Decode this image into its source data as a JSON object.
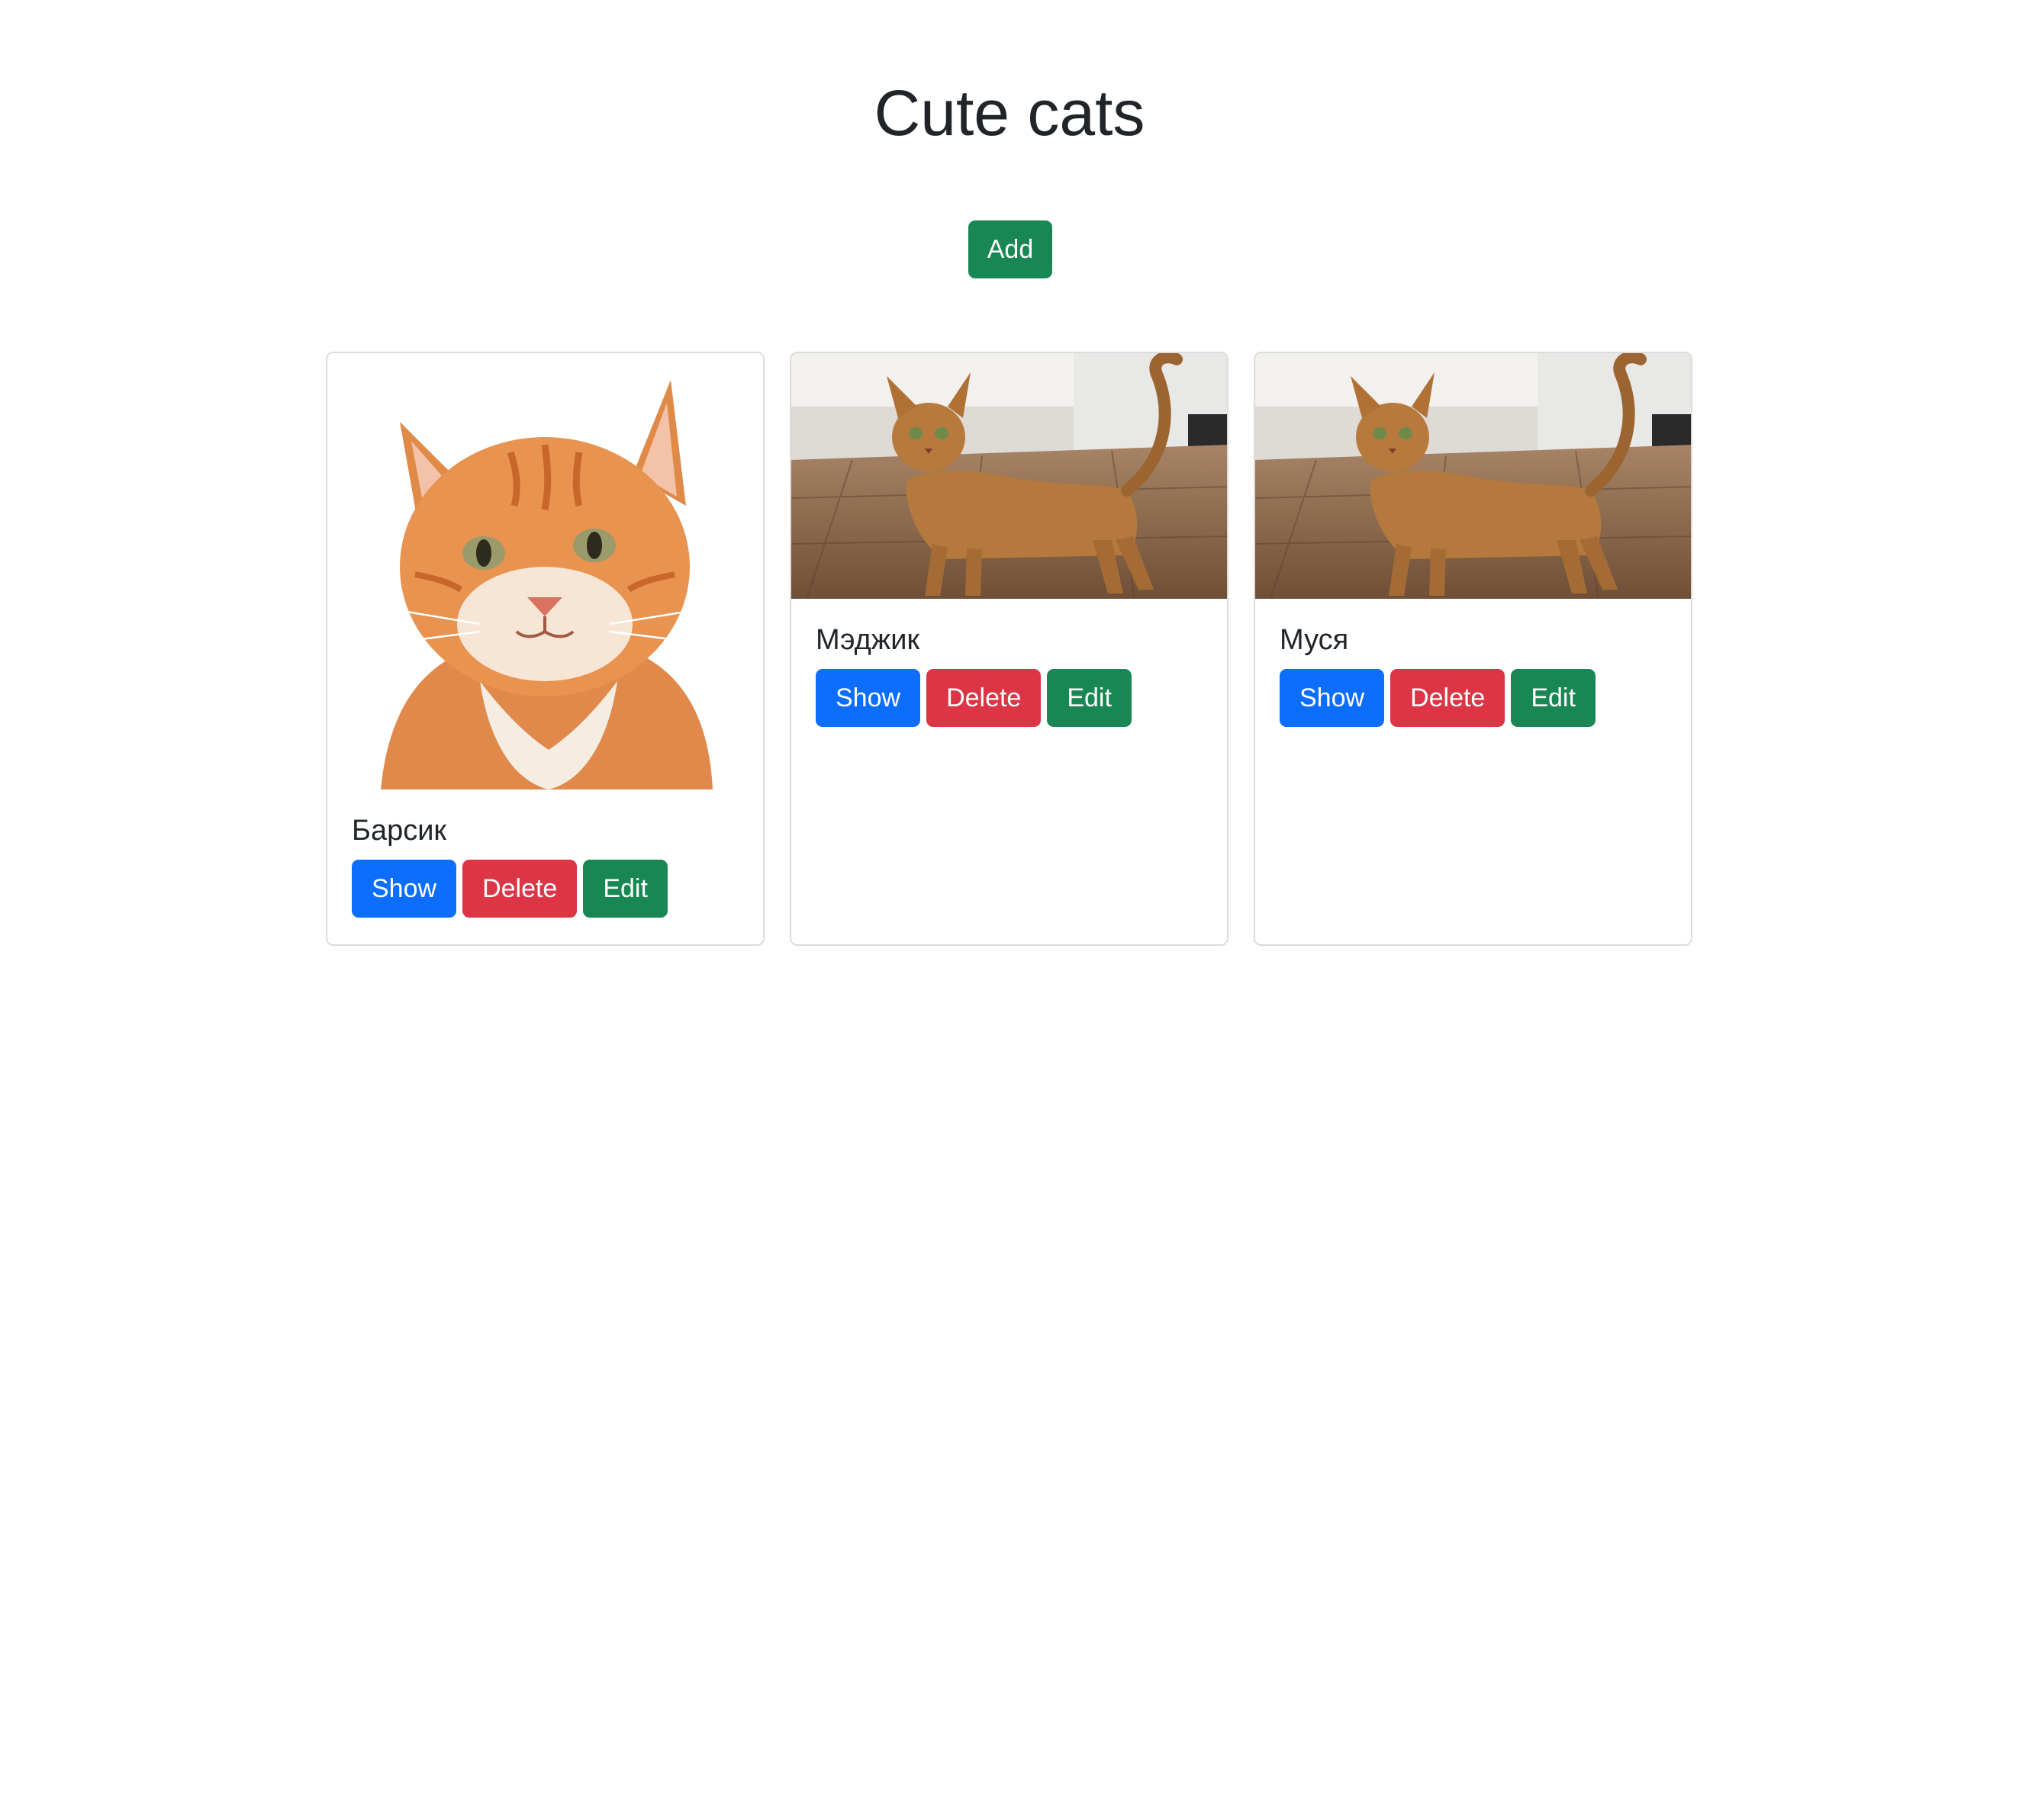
{
  "page": {
    "title": "Cute cats"
  },
  "toolbar": {
    "add_label": "Add"
  },
  "colors": {
    "success": "#198754",
    "primary": "#0d6efd",
    "danger": "#dc3545",
    "text": "#212529"
  },
  "cards": [
    {
      "name": "Барсик",
      "image": "orange-tabby-cat-portrait",
      "show_label": "Show",
      "delete_label": "Delete",
      "edit_label": "Edit"
    },
    {
      "name": "Мэджик",
      "image": "abyssinian-cat-standing-on-floor",
      "show_label": "Show",
      "delete_label": "Delete",
      "edit_label": "Edit"
    },
    {
      "name": "Муся",
      "image": "abyssinian-cat-standing-on-floor",
      "show_label": "Show",
      "delete_label": "Delete",
      "edit_label": "Edit"
    }
  ]
}
